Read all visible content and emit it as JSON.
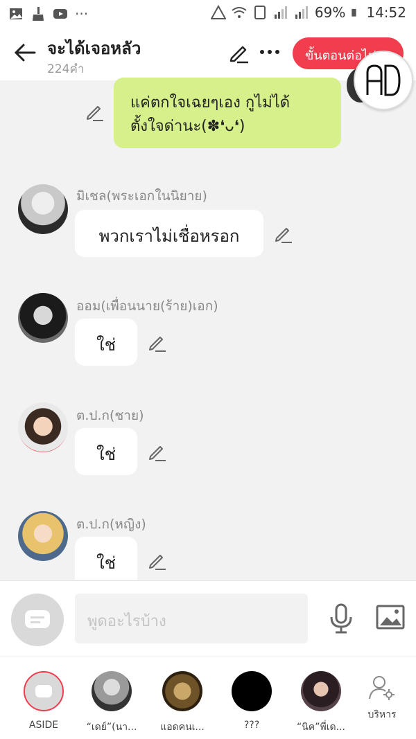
{
  "status_bar": {
    "battery": "69%",
    "time": "14:52"
  },
  "header": {
    "title": "จะได้เจอหลัว",
    "subtitle": "224คำ",
    "next_button": "ขั้นตอนต่อไป",
    "ad_logo": "AD"
  },
  "messages": [
    {
      "side": "right",
      "text_line1": "แค่ตกใจเฉยๆเอง กูไม่ได้",
      "text_line2": "ตั้งใจด่านะ(✽❛ᴗ❛)"
    },
    {
      "side": "left",
      "name": "มิเชล(พระเอกในนิยาย)",
      "text": "พวกเราไม่เชื่อหรอก"
    },
    {
      "side": "left",
      "name": "ออม(เพื่อนนาย(ร้าย)เอก)",
      "text": "ใช่"
    },
    {
      "side": "left",
      "name": "ต.ป.ก(ชาย)",
      "text": "ใช่"
    },
    {
      "side": "left",
      "name": "ต.ป.ก(หญิง)",
      "text": "ใช่"
    }
  ],
  "input": {
    "placeholder": "พูดอะไรบ้าง"
  },
  "bottom_nav": [
    {
      "label": "ASIDE"
    },
    {
      "label": "“เดย์”(นา..."
    },
    {
      "label": "แอดคนเ..."
    },
    {
      "label": "???"
    },
    {
      "label": "“นิค”พี่เด..."
    },
    {
      "label": "บริหาร"
    }
  ],
  "colors": {
    "accent": "#f23d4e",
    "bubble_right": "#d6f08b",
    "background": "#f2f2f2"
  }
}
